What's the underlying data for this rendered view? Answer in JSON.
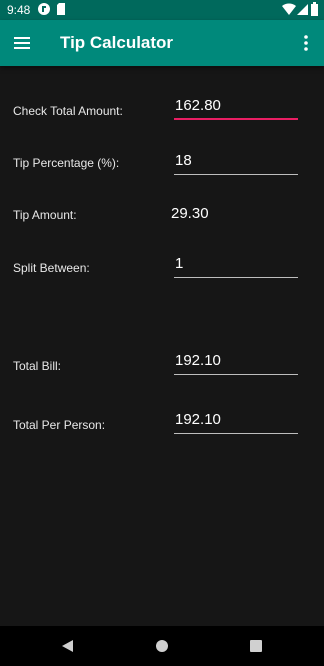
{
  "status_bar": {
    "time": "9:48",
    "icons": [
      "notification-app-icon",
      "sd-card-icon",
      "wifi-icon",
      "signal-icon",
      "battery-icon"
    ]
  },
  "app_bar": {
    "title": "Tip Calculator",
    "menu_icon": "hamburger-menu-icon",
    "overflow_icon": "more-vert-icon",
    "color": "#00897b",
    "status_color": "#00695c"
  },
  "form": {
    "check_total": {
      "label": "Check Total Amount:",
      "value": "162.80"
    },
    "tip_percentage": {
      "label": "Tip Percentage (%):",
      "value": "18"
    },
    "tip_amount": {
      "label": "Tip Amount:",
      "value": "29.30"
    },
    "split_between": {
      "label": "Split Between:",
      "value": "1"
    },
    "total_bill": {
      "label": "Total Bill:",
      "value": "192.10"
    },
    "total_per_person": {
      "label": "Total Per Person:",
      "value": "192.10"
    }
  },
  "accent_color": "#e91e63",
  "nav_bar": {
    "back_icon": "back-triangle-icon",
    "home_icon": "home-circle-icon",
    "recents_icon": "recents-square-icon"
  }
}
